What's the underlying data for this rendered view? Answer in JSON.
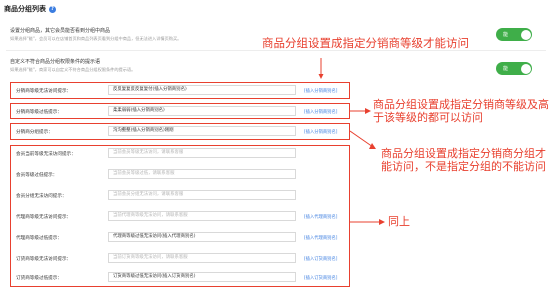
{
  "header": {
    "title": "商品分组列表",
    "help_icon": "?"
  },
  "section1": {
    "title": "设置分组商品，其它会员能否看到分组中商品",
    "desc": "如果选择\"能\"，会员可以在店铺首页和商品列表页看到分组中商品，但无法进入详情页购买。",
    "toggle_label": "能"
  },
  "section2": {
    "title": "自定义不符合商品分组权限条件的提示语",
    "desc": "如果选择\"能\"，商家可以自定义不符合商品分组权限条件的提示语。",
    "toggle_label": "能"
  },
  "rows": [
    {
      "label": "分销商等级无法访问提示：",
      "value": "反反复复反反复复付(插入分销商别名)",
      "placeholder": "",
      "link": "[插入分销商别名]"
    },
    {
      "label": "分销商等级过低提示：",
      "value": "柔柔弱弱(插入分销商别名)",
      "placeholder": "",
      "link": "[插入分销商别名]"
    },
    {
      "label": "分销商分组提示：",
      "value": "沟沟壑壑(插入分销商别名)刚刚",
      "placeholder": "",
      "link": "[插入分销商别名]"
    },
    {
      "label": "会员当前等级无法访问提示：",
      "value": "",
      "placeholder": "当前会员等级无法访问，请联系客服",
      "link": ""
    },
    {
      "label": "会员等级过低提示：",
      "value": "",
      "placeholder": "当前会员等级过低，请联系客服",
      "link": ""
    },
    {
      "label": "会员分组无法访问提示：",
      "value": "",
      "placeholder": "当前会员分组无法访问，请联系客服",
      "link": ""
    },
    {
      "label": "代理商等级无法访问提示：",
      "value": "",
      "placeholder": "当前代理商等级无法访问，请联系客服",
      "link": "[插入代理商别名]"
    },
    {
      "label": "代理商等级过低提示：",
      "value": "代理商等级过低无法访问(插入代理商别名)",
      "placeholder": "",
      "link": "[插入代理商别名]"
    },
    {
      "label": "订货商等级无法访问提示：",
      "value": "",
      "placeholder": "当前订货商等级无法访问，请联系客服",
      "link": "[插入订货商别名]"
    },
    {
      "label": "订货商等级过低提示：",
      "value": "订货商等级过低无法访问(插入订货商别名)",
      "placeholder": "",
      "link": "[插入订货商别名]"
    }
  ],
  "annotations": {
    "a1": "商品分组设置成指定分销商等级才能访问",
    "a2_line1": "商品分组设置成指定分销商等级及高",
    "a2_line2": "于该等级的都可以访问",
    "a3_line1": "商品分组设置成指定分销商分组才",
    "a3_line2": "能访问，不是指定分组的不能访问",
    "a4": "同上"
  },
  "colors": {
    "accent": "#3fae49",
    "annotation": "#e8402f",
    "link": "#3b7de0"
  }
}
